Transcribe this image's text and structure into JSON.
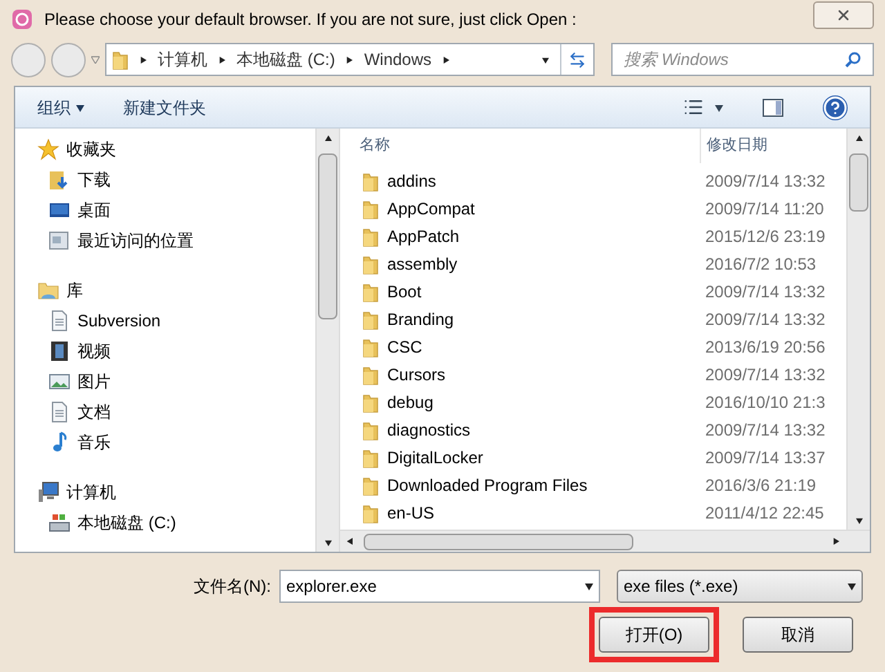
{
  "window": {
    "title": "Please choose your default browser. If you are not sure, just click Open :"
  },
  "address_bar": {
    "crumbs": [
      "计算机",
      "本地磁盘 (C:)",
      "Windows"
    ]
  },
  "search": {
    "placeholder": "搜索 Windows"
  },
  "toolbar": {
    "organize": "组织",
    "new_folder": "新建文件夹"
  },
  "sidebar": {
    "groups": [
      {
        "label": "收藏夹",
        "kind": "favorites",
        "children": [
          {
            "label": "下载",
            "kind": "download"
          },
          {
            "label": "桌面",
            "kind": "desktop"
          },
          {
            "label": "最近访问的位置",
            "kind": "recent"
          }
        ]
      },
      {
        "label": "库",
        "kind": "library",
        "children": [
          {
            "label": "Subversion",
            "kind": "doc"
          },
          {
            "label": "视频",
            "kind": "video"
          },
          {
            "label": "图片",
            "kind": "picture"
          },
          {
            "label": "文档",
            "kind": "doc"
          },
          {
            "label": "音乐",
            "kind": "music"
          }
        ]
      },
      {
        "label": "计算机",
        "kind": "computer",
        "children": [
          {
            "label": "本地磁盘 (C:)",
            "kind": "drive"
          }
        ]
      }
    ]
  },
  "file_list": {
    "columns": [
      "名称",
      "修改日期"
    ],
    "rows": [
      {
        "name": "addins",
        "date": "2009/7/14 13:32"
      },
      {
        "name": "AppCompat",
        "date": "2009/7/14 11:20"
      },
      {
        "name": "AppPatch",
        "date": "2015/12/6 23:19"
      },
      {
        "name": "assembly",
        "date": "2016/7/2 10:53"
      },
      {
        "name": "Boot",
        "date": "2009/7/14 13:32"
      },
      {
        "name": "Branding",
        "date": "2009/7/14 13:32"
      },
      {
        "name": "CSC",
        "date": "2013/6/19 20:56"
      },
      {
        "name": "Cursors",
        "date": "2009/7/14 13:32"
      },
      {
        "name": "debug",
        "date": "2016/10/10 21:3"
      },
      {
        "name": "diagnostics",
        "date": "2009/7/14 13:32"
      },
      {
        "name": "DigitalLocker",
        "date": "2009/7/14 13:37"
      },
      {
        "name": "Downloaded Program Files",
        "date": "2016/3/6 21:19"
      },
      {
        "name": "en-US",
        "date": "2011/4/12 22:45"
      }
    ]
  },
  "file_name": {
    "label": "文件名(N):",
    "value": "explorer.exe"
  },
  "file_type": {
    "value": "exe files (*.exe)"
  },
  "buttons": [
    {
      "label": "打开(O)",
      "highlighted": true
    },
    {
      "label": "取消",
      "highlighted": false
    }
  ]
}
